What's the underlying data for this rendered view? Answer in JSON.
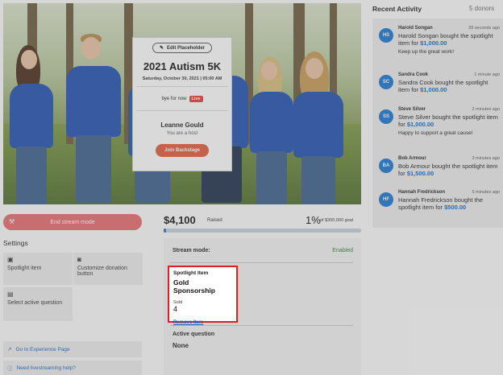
{
  "hero": {
    "edit_placeholder": "Edit Placeholder",
    "title": "2021 Autism 5K",
    "date": "Saturday, October 30, 2021 | 05:00 AM",
    "bye_text": "bye for now",
    "live_badge": "Live",
    "host_name": "Leanne Gould",
    "host_role": "You are a host",
    "backstage_button": "Join Backstage"
  },
  "stream": {
    "end_button": "End stream mode"
  },
  "settings": {
    "title": "Settings",
    "tiles": [
      "Spotlight item",
      "Customize donation button",
      "Select active question"
    ],
    "links": [
      "Go to Experience Page",
      "Need livestreaming help?"
    ]
  },
  "stats": {
    "raised": "$4,100",
    "raised_label": "Raised",
    "percent": "1%",
    "goal": "of $300,000 goal",
    "progress_fraction": 0.014
  },
  "stream_panel": {
    "mode_label": "Stream mode:",
    "mode_value": "Enabled",
    "spotlight_label": "Spotlight Item",
    "spotlight_name": "Gold Sponsorship",
    "sold_label": "Sold",
    "sold_value": "4",
    "remove_label": "Remove Item",
    "active_question_label": "Active question",
    "active_question_value": "None"
  },
  "activity": {
    "title": "Recent Activity",
    "count": "5 donors",
    "items": [
      {
        "initials": "HS",
        "name": "Harold Songan",
        "time": "39 seconds ago",
        "msg": "Harold Songan bought the spotlight item for ",
        "amount": "$1,000.00",
        "comment": "Keep up the great work!"
      },
      {
        "initials": "SC",
        "name": "Sandra Cook",
        "time": "1 minute ago",
        "msg": "Sandra Cook bought the spotlight item for ",
        "amount": "$1,000.00",
        "comment": ""
      },
      {
        "initials": "SS",
        "name": "Steve Silver",
        "time": "2 minutes ago",
        "msg": "Steve Silver bought the spotlight item for ",
        "amount": "$1,000.00",
        "comment": "Happy to support a great cause!"
      },
      {
        "initials": "BA",
        "name": "Bob Armour",
        "time": "3 minutes ago",
        "msg": "Bob Armour bought the spotlight item for ",
        "amount": "$1,500.00",
        "comment": ""
      },
      {
        "initials": "HF",
        "name": "Hannah Fredrickson",
        "time": "5 minutes ago",
        "msg": "Hannah Fredrickson bought the spotlight item for ",
        "amount": "$500.00",
        "comment": ""
      }
    ]
  }
}
